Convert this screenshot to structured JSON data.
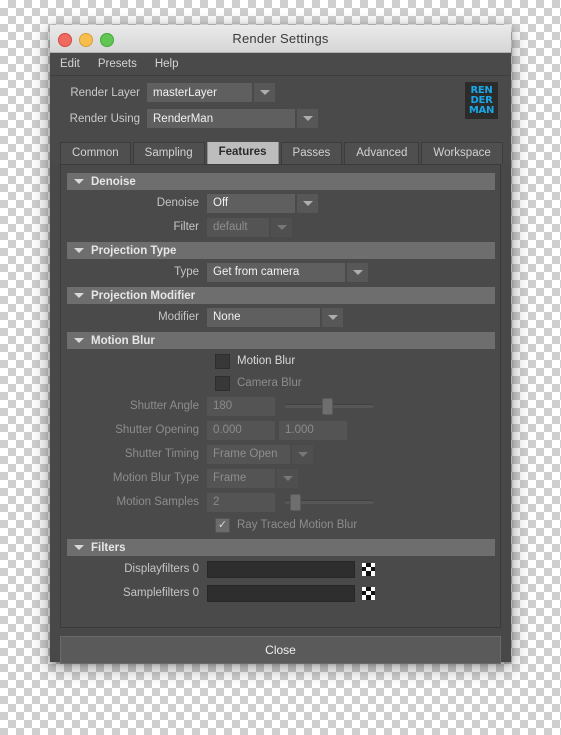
{
  "window": {
    "title": "Render Settings",
    "traffic_lights": [
      "close-button",
      "minimize-button",
      "maximize-button"
    ]
  },
  "menubar": {
    "items": [
      {
        "label": "Edit"
      },
      {
        "label": "Presets"
      },
      {
        "label": "Help"
      }
    ]
  },
  "toprows": {
    "render_layer": {
      "label": "Render Layer",
      "value": "masterLayer"
    },
    "render_using": {
      "label": "Render Using",
      "value": "RenderMan"
    }
  },
  "logo": {
    "line1": "REN",
    "line2": "DER",
    "line3": "MAN",
    "color": "#1ba8e8"
  },
  "tabs": [
    {
      "label": "Common",
      "active": false
    },
    {
      "label": "Sampling",
      "active": false
    },
    {
      "label": "Features",
      "active": true
    },
    {
      "label": "Passes",
      "active": false
    },
    {
      "label": "Advanced",
      "active": false
    },
    {
      "label": "Workspace",
      "active": false
    }
  ],
  "sections": {
    "denoise": {
      "title": "Denoise",
      "denoise": {
        "label": "Denoise",
        "value": "Off"
      },
      "filter": {
        "label": "Filter",
        "value": "default"
      }
    },
    "projection_type": {
      "title": "Projection Type",
      "type": {
        "label": "Type",
        "value": "Get from camera"
      }
    },
    "projection_modifier": {
      "title": "Projection Modifier",
      "modifier": {
        "label": "Modifier",
        "value": "None"
      }
    },
    "motion_blur": {
      "title": "Motion Blur",
      "motion_blur_check": {
        "label": "Motion Blur",
        "checked": false
      },
      "camera_blur_check": {
        "label": "Camera Blur",
        "checked": false
      },
      "shutter_angle": {
        "label": "Shutter Angle",
        "value": "180",
        "slider_pct": 42
      },
      "shutter_opening": {
        "label": "Shutter Opening",
        "value1": "0.000",
        "value2": "1.000"
      },
      "shutter_timing": {
        "label": "Shutter Timing",
        "value": "Frame Open"
      },
      "motion_blur_type": {
        "label": "Motion Blur Type",
        "value": "Frame"
      },
      "motion_samples": {
        "label": "Motion Samples",
        "value": "2",
        "slider_pct": 6
      },
      "ray_traced_check": {
        "label": "Ray Traced Motion Blur",
        "checked": true
      }
    },
    "filters": {
      "title": "Filters",
      "displayfilters": {
        "label": "Displayfilters 0",
        "value": ""
      },
      "samplefilters": {
        "label": "Samplefilters 0",
        "value": ""
      }
    }
  },
  "footer": {
    "close_label": "Close"
  }
}
